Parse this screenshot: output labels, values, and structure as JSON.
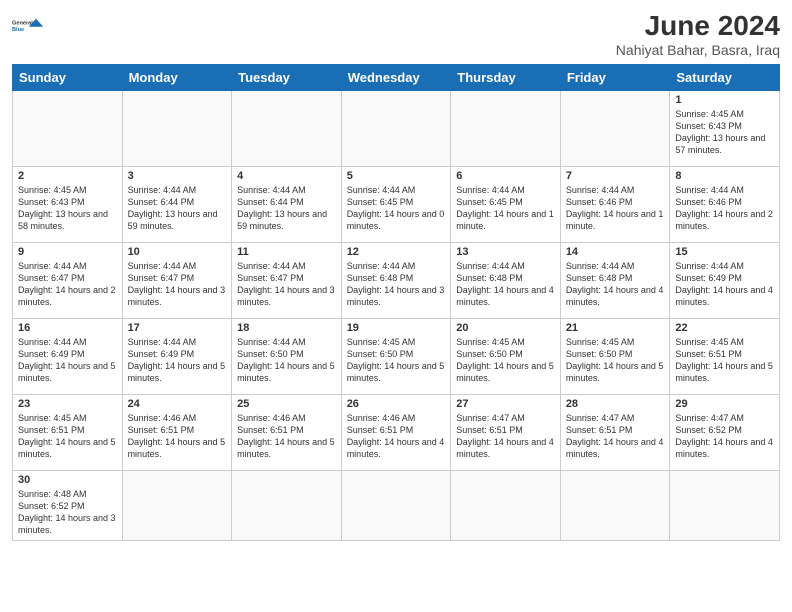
{
  "logo": {
    "general": "General",
    "blue": "Blue"
  },
  "title": "June 2024",
  "subtitle": "Nahiyat Bahar, Basra, Iraq",
  "headers": [
    "Sunday",
    "Monday",
    "Tuesday",
    "Wednesday",
    "Thursday",
    "Friday",
    "Saturday"
  ],
  "weeks": [
    [
      {
        "date": "",
        "text": ""
      },
      {
        "date": "",
        "text": ""
      },
      {
        "date": "",
        "text": ""
      },
      {
        "date": "",
        "text": ""
      },
      {
        "date": "",
        "text": ""
      },
      {
        "date": "",
        "text": ""
      },
      {
        "date": "1",
        "text": "Sunrise: 4:45 AM\nSunset: 6:43 PM\nDaylight: 13 hours\nand 57 minutes."
      }
    ],
    [
      {
        "date": "2",
        "text": "Sunrise: 4:45 AM\nSunset: 6:43 PM\nDaylight: 13 hours\nand 58 minutes."
      },
      {
        "date": "3",
        "text": "Sunrise: 4:44 AM\nSunset: 6:44 PM\nDaylight: 13 hours\nand 59 minutes."
      },
      {
        "date": "4",
        "text": "Sunrise: 4:44 AM\nSunset: 6:44 PM\nDaylight: 13 hours\nand 59 minutes."
      },
      {
        "date": "5",
        "text": "Sunrise: 4:44 AM\nSunset: 6:45 PM\nDaylight: 14 hours\nand 0 minutes."
      },
      {
        "date": "6",
        "text": "Sunrise: 4:44 AM\nSunset: 6:45 PM\nDaylight: 14 hours\nand 1 minute."
      },
      {
        "date": "7",
        "text": "Sunrise: 4:44 AM\nSunset: 6:46 PM\nDaylight: 14 hours\nand 1 minute."
      },
      {
        "date": "8",
        "text": "Sunrise: 4:44 AM\nSunset: 6:46 PM\nDaylight: 14 hours\nand 2 minutes."
      }
    ],
    [
      {
        "date": "9",
        "text": "Sunrise: 4:44 AM\nSunset: 6:47 PM\nDaylight: 14 hours\nand 2 minutes."
      },
      {
        "date": "10",
        "text": "Sunrise: 4:44 AM\nSunset: 6:47 PM\nDaylight: 14 hours\nand 3 minutes."
      },
      {
        "date": "11",
        "text": "Sunrise: 4:44 AM\nSunset: 6:47 PM\nDaylight: 14 hours\nand 3 minutes."
      },
      {
        "date": "12",
        "text": "Sunrise: 4:44 AM\nSunset: 6:48 PM\nDaylight: 14 hours\nand 3 minutes."
      },
      {
        "date": "13",
        "text": "Sunrise: 4:44 AM\nSunset: 6:48 PM\nDaylight: 14 hours\nand 4 minutes."
      },
      {
        "date": "14",
        "text": "Sunrise: 4:44 AM\nSunset: 6:48 PM\nDaylight: 14 hours\nand 4 minutes."
      },
      {
        "date": "15",
        "text": "Sunrise: 4:44 AM\nSunset: 6:49 PM\nDaylight: 14 hours\nand 4 minutes."
      }
    ],
    [
      {
        "date": "16",
        "text": "Sunrise: 4:44 AM\nSunset: 6:49 PM\nDaylight: 14 hours\nand 5 minutes."
      },
      {
        "date": "17",
        "text": "Sunrise: 4:44 AM\nSunset: 6:49 PM\nDaylight: 14 hours\nand 5 minutes."
      },
      {
        "date": "18",
        "text": "Sunrise: 4:44 AM\nSunset: 6:50 PM\nDaylight: 14 hours\nand 5 minutes."
      },
      {
        "date": "19",
        "text": "Sunrise: 4:45 AM\nSunset: 6:50 PM\nDaylight: 14 hours\nand 5 minutes."
      },
      {
        "date": "20",
        "text": "Sunrise: 4:45 AM\nSunset: 6:50 PM\nDaylight: 14 hours\nand 5 minutes."
      },
      {
        "date": "21",
        "text": "Sunrise: 4:45 AM\nSunset: 6:50 PM\nDaylight: 14 hours\nand 5 minutes."
      },
      {
        "date": "22",
        "text": "Sunrise: 4:45 AM\nSunset: 6:51 PM\nDaylight: 14 hours\nand 5 minutes."
      }
    ],
    [
      {
        "date": "23",
        "text": "Sunrise: 4:45 AM\nSunset: 6:51 PM\nDaylight: 14 hours\nand 5 minutes."
      },
      {
        "date": "24",
        "text": "Sunrise: 4:46 AM\nSunset: 6:51 PM\nDaylight: 14 hours\nand 5 minutes."
      },
      {
        "date": "25",
        "text": "Sunrise: 4:46 AM\nSunset: 6:51 PM\nDaylight: 14 hours\nand 5 minutes."
      },
      {
        "date": "26",
        "text": "Sunrise: 4:46 AM\nSunset: 6:51 PM\nDaylight: 14 hours\nand 4 minutes."
      },
      {
        "date": "27",
        "text": "Sunrise: 4:47 AM\nSunset: 6:51 PM\nDaylight: 14 hours\nand 4 minutes."
      },
      {
        "date": "28",
        "text": "Sunrise: 4:47 AM\nSunset: 6:51 PM\nDaylight: 14 hours\nand 4 minutes."
      },
      {
        "date": "29",
        "text": "Sunrise: 4:47 AM\nSunset: 6:52 PM\nDaylight: 14 hours\nand 4 minutes."
      }
    ],
    [
      {
        "date": "30",
        "text": "Sunrise: 4:48 AM\nSunset: 6:52 PM\nDaylight: 14 hours\nand 3 minutes."
      },
      {
        "date": "",
        "text": ""
      },
      {
        "date": "",
        "text": ""
      },
      {
        "date": "",
        "text": ""
      },
      {
        "date": "",
        "text": ""
      },
      {
        "date": "",
        "text": ""
      },
      {
        "date": "",
        "text": ""
      }
    ]
  ]
}
